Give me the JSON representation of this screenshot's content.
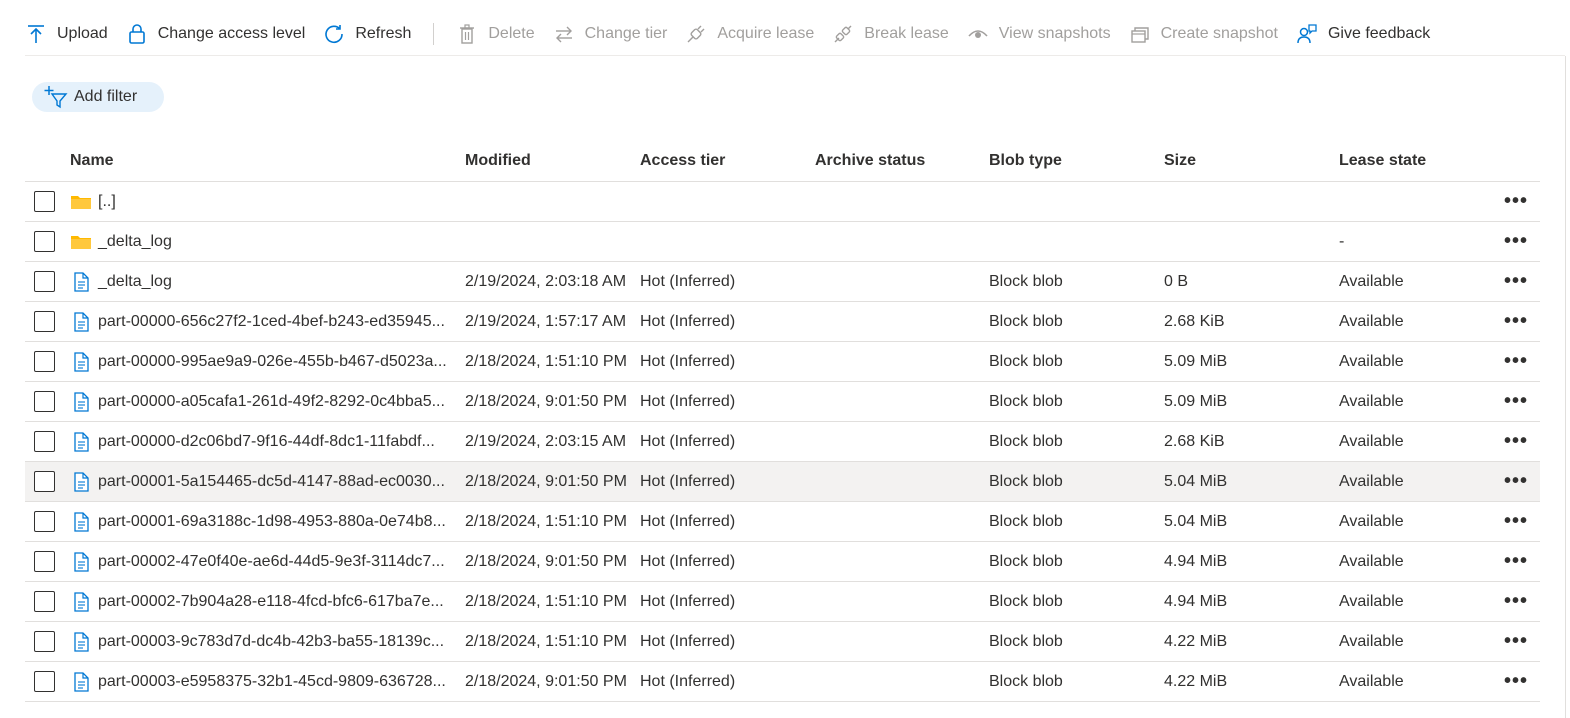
{
  "toolbar": {
    "upload": "Upload",
    "change_access": "Change access level",
    "refresh": "Refresh",
    "delete": "Delete",
    "change_tier": "Change tier",
    "acquire_lease": "Acquire lease",
    "break_lease": "Break lease",
    "view_snapshots": "View snapshots",
    "create_snapshot": "Create snapshot",
    "give_feedback": "Give feedback"
  },
  "filter": {
    "label": "Add filter"
  },
  "columns": {
    "name": "Name",
    "modified": "Modified",
    "tier": "Access tier",
    "archive": "Archive status",
    "blob_type": "Blob type",
    "size": "Size",
    "lease": "Lease state"
  },
  "more_glyph": "•••",
  "rows": [
    {
      "icon": "folder-icon",
      "name": "[..]",
      "modified": "",
      "tier": "",
      "archive": "",
      "blob_type": "",
      "size": "",
      "lease": ""
    },
    {
      "icon": "folder-icon",
      "name": "_delta_log",
      "modified": "",
      "tier": "",
      "archive": "",
      "blob_type": "",
      "size": "",
      "lease": "-"
    },
    {
      "icon": "file-icon",
      "name": "_delta_log",
      "modified": "2/19/2024, 2:03:18 AM",
      "tier": "Hot (Inferred)",
      "archive": "",
      "blob_type": "Block blob",
      "size": "0 B",
      "lease": "Available"
    },
    {
      "icon": "file-icon",
      "name": "part-00000-656c27f2-1ced-4bef-b243-ed35945...",
      "modified": "2/19/2024, 1:57:17 AM",
      "tier": "Hot (Inferred)",
      "archive": "",
      "blob_type": "Block blob",
      "size": "2.68 KiB",
      "lease": "Available"
    },
    {
      "icon": "file-icon",
      "name": "part-00000-995ae9a9-026e-455b-b467-d5023a...",
      "modified": "2/18/2024, 1:51:10 PM",
      "tier": "Hot (Inferred)",
      "archive": "",
      "blob_type": "Block blob",
      "size": "5.09 MiB",
      "lease": "Available"
    },
    {
      "icon": "file-icon",
      "name": "part-00000-a05cafa1-261d-49f2-8292-0c4bba5...",
      "modified": "2/18/2024, 9:01:50 PM",
      "tier": "Hot (Inferred)",
      "archive": "",
      "blob_type": "Block blob",
      "size": "5.09 MiB",
      "lease": "Available"
    },
    {
      "icon": "file-icon",
      "name": "part-00000-d2c06bd7-9f16-44df-8dc1-11fabdf...",
      "modified": "2/19/2024, 2:03:15 AM",
      "tier": "Hot (Inferred)",
      "archive": "",
      "blob_type": "Block blob",
      "size": "2.68 KiB",
      "lease": "Available"
    },
    {
      "icon": "file-icon",
      "name": "part-00001-5a154465-dc5d-4147-88ad-ec0030...",
      "modified": "2/18/2024, 9:01:50 PM",
      "tier": "Hot (Inferred)",
      "archive": "",
      "blob_type": "Block blob",
      "size": "5.04 MiB",
      "lease": "Available",
      "highlighted": true
    },
    {
      "icon": "file-icon",
      "name": "part-00001-69a3188c-1d98-4953-880a-0e74b8...",
      "modified": "2/18/2024, 1:51:10 PM",
      "tier": "Hot (Inferred)",
      "archive": "",
      "blob_type": "Block blob",
      "size": "5.04 MiB",
      "lease": "Available"
    },
    {
      "icon": "file-icon",
      "name": "part-00002-47e0f40e-ae6d-44d5-9e3f-3114dc7...",
      "modified": "2/18/2024, 9:01:50 PM",
      "tier": "Hot (Inferred)",
      "archive": "",
      "blob_type": "Block blob",
      "size": "4.94 MiB",
      "lease": "Available"
    },
    {
      "icon": "file-icon",
      "name": "part-00002-7b904a28-e118-4fcd-bfc6-617ba7e...",
      "modified": "2/18/2024, 1:51:10 PM",
      "tier": "Hot (Inferred)",
      "archive": "",
      "blob_type": "Block blob",
      "size": "4.94 MiB",
      "lease": "Available"
    },
    {
      "icon": "file-icon",
      "name": "part-00003-9c783d7d-dc4b-42b3-ba55-18139c...",
      "modified": "2/18/2024, 1:51:10 PM",
      "tier": "Hot (Inferred)",
      "archive": "",
      "blob_type": "Block blob",
      "size": "4.22 MiB",
      "lease": "Available"
    },
    {
      "icon": "file-icon",
      "name": "part-00003-e5958375-32b1-45cd-9809-636728...",
      "modified": "2/18/2024, 9:01:50 PM",
      "tier": "Hot (Inferred)",
      "archive": "",
      "blob_type": "Block blob",
      "size": "4.22 MiB",
      "lease": "Available"
    }
  ],
  "colors": {
    "accent": "#0078d4",
    "folder": "#ffb900",
    "disabled": "#a19f9d",
    "pill": "#e5f1fb",
    "row_highlight": "#f3f2f1"
  }
}
